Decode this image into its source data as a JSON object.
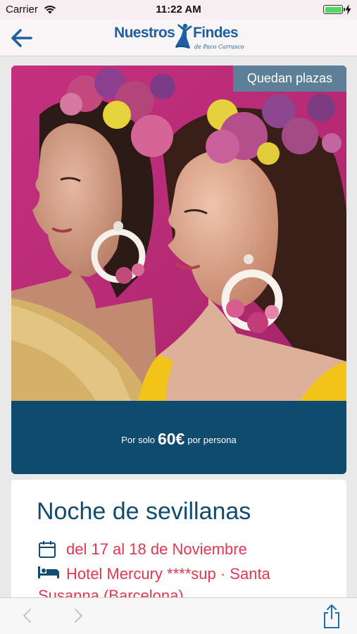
{
  "status_bar": {
    "carrier": "Carrier",
    "time": "11:22 AM",
    "battery_level": 1.0,
    "charging": true
  },
  "nav": {
    "back_icon": "arrow-left-icon",
    "logo_word_1": "Nuestros",
    "logo_word_2": "Findes",
    "logo_sub": "de Paco Carrasco",
    "accent_color": "#1d5fa3"
  },
  "event": {
    "badge": "Quedan plazas",
    "price_prefix": "Por solo",
    "price_amount": "60€",
    "price_suffix": "por persona",
    "title": "Noche de sevillanas",
    "date_icon": "calendar-icon",
    "dates": "del 17 al 18 de Noviembre",
    "hotel_icon": "bed-icon",
    "hotel": "Hotel Mercury ****sup · Santa Susanna (Barcelona)"
  },
  "colors": {
    "price_bar": "#0e4b6e",
    "badge": "#5d7f98",
    "title": "#0f4c70",
    "highlight": "#e3364f"
  },
  "toolbar": {
    "back_icon": "chevron-left-icon",
    "forward_icon": "chevron-right-icon",
    "share_icon": "share-icon"
  }
}
